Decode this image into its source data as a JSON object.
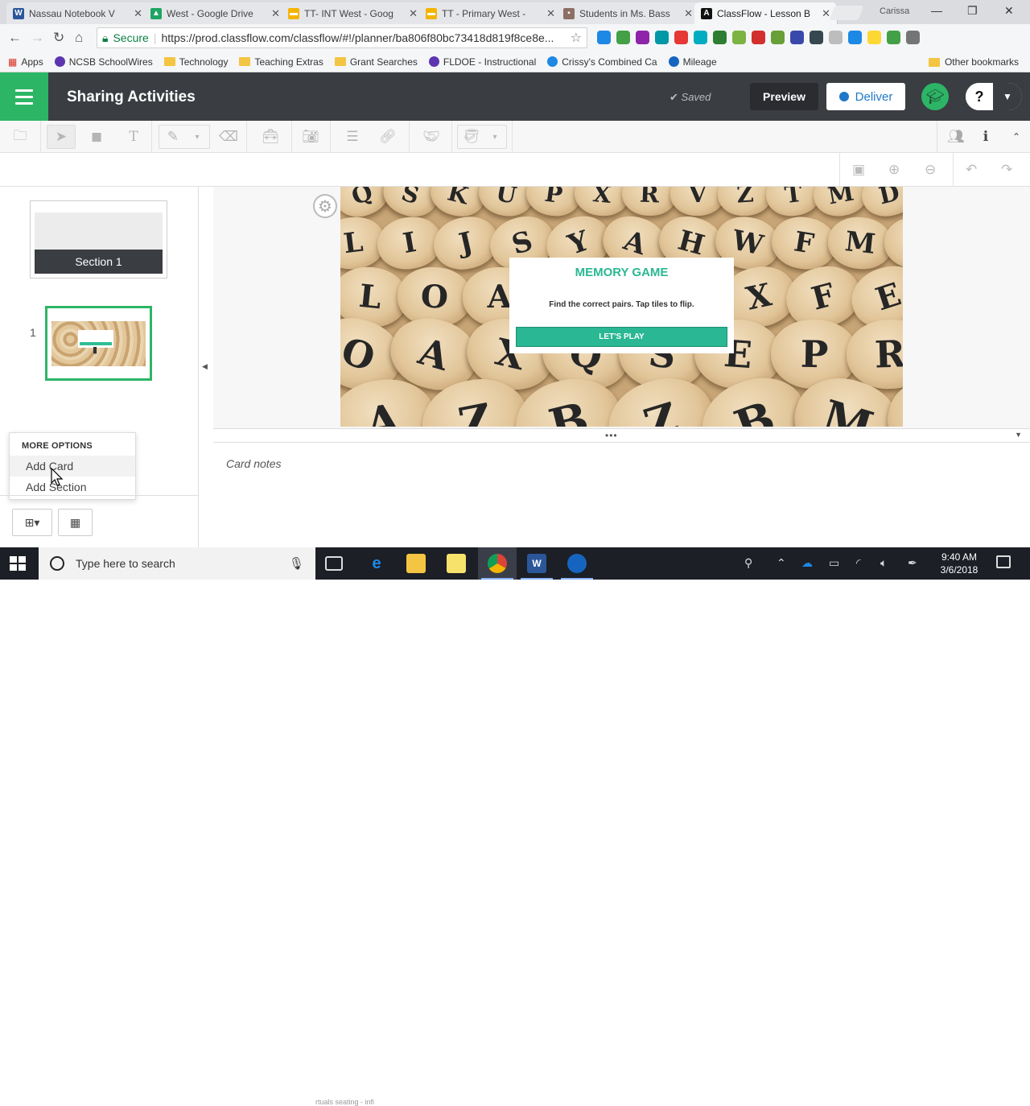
{
  "browser": {
    "tabs": [
      {
        "title": "Nassau Notebook V",
        "favicon_color": "#2b579a",
        "favicon_letter": "W"
      },
      {
        "title": "West - Google Drive",
        "favicon_color": "#1fa463",
        "favicon_letter": "▲"
      },
      {
        "title": "TT- INT West - Goog",
        "favicon_color": "#f4b400",
        "favicon_letter": "▬"
      },
      {
        "title": "TT - Primary West - ",
        "favicon_color": "#f4b400",
        "favicon_letter": "▬"
      },
      {
        "title": "Students in Ms. Bass",
        "favicon_color": "#8d6e63",
        "favicon_letter": "▪"
      },
      {
        "title": "ClassFlow - Lesson B",
        "favicon_color": "#111111",
        "favicon_letter": "A"
      }
    ],
    "user": "Carissa",
    "secure_label": "Secure",
    "url": "https://prod.classflow.com/classflow/#!/planner/ba806f80bc73418d819f8ce8e...",
    "extension_colors": [
      "#1e88e5",
      "#43a047",
      "#8e24aa",
      "#0097a7",
      "#e53935",
      "#00acc1",
      "#2e7d32",
      "#7cb342",
      "#d32f2f",
      "#689f38",
      "#3949ab",
      "#37474f",
      "#bdbdbd",
      "#1e88e5",
      "#fdd835",
      "#43a047",
      "#757575"
    ],
    "bookmarks": [
      {
        "label": "Apps",
        "icon": "apps-grid-icon"
      },
      {
        "label": "NCSB SchoolWires",
        "icon": "site-icon"
      },
      {
        "label": "Technology",
        "icon": "folder-icon"
      },
      {
        "label": "Teaching Extras",
        "icon": "folder-icon"
      },
      {
        "label": "Grant Searches",
        "icon": "folder-icon"
      },
      {
        "label": "FLDOE - Instructional",
        "icon": "site-icon"
      },
      {
        "label": "Crissy's Combined Ca",
        "icon": "calendar-icon"
      },
      {
        "label": "Mileage",
        "icon": "globe-icon"
      }
    ],
    "other_bookmarks": "Other bookmarks"
  },
  "app": {
    "title": "Sharing Activities",
    "saved_label": "Saved",
    "preview_label": "Preview",
    "deliver_label": "Deliver",
    "help_label": "?",
    "accent_color": "#2db566"
  },
  "sidebar": {
    "section_label": "Section 1",
    "card_number": "1",
    "menu_header": "MORE OPTIONS",
    "menu_items": [
      "Add Card",
      "Add Section"
    ]
  },
  "slide": {
    "game_title": "MEMORY GAME",
    "instructions": "Find the correct pairs. Tap tiles to flip.",
    "play_button": "LET'S PLAY",
    "teal_color": "#2ab793"
  },
  "notes_placeholder": "Card notes",
  "taskbar": {
    "search_placeholder": "Type here to search",
    "time": "9:40 AM",
    "date": "3/6/2018",
    "preview_text": "rtuals seating - infi"
  }
}
